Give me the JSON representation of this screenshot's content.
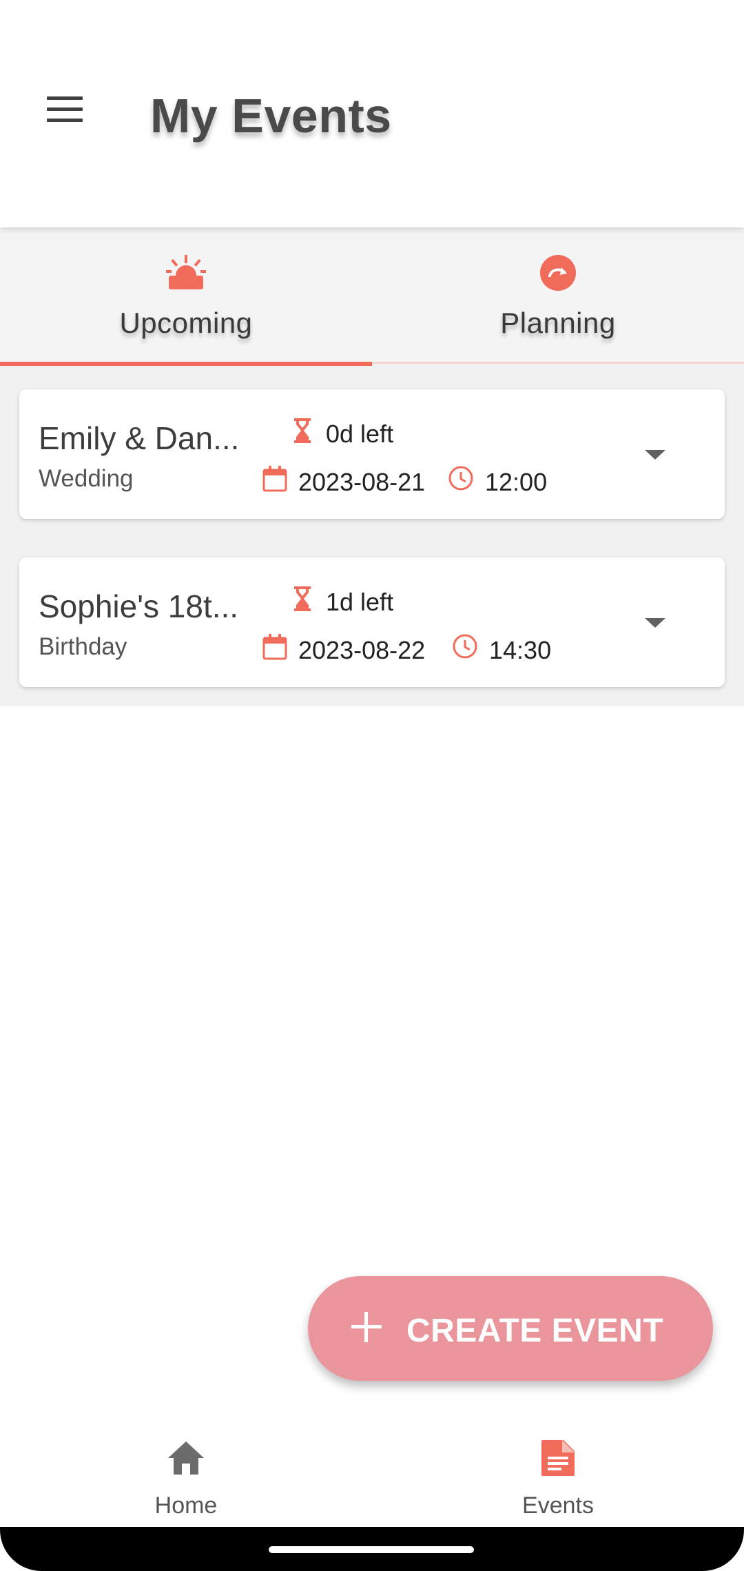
{
  "header": {
    "title": "My Events",
    "menu_icon": "menu-icon"
  },
  "tabs": [
    {
      "label": "Upcoming",
      "icon": "alarm-light-icon",
      "active": true
    },
    {
      "label": "Planning",
      "icon": "redo-circle-icon",
      "active": false
    }
  ],
  "events": [
    {
      "name": "Emily & Dan...",
      "type": "Wedding",
      "time_left": "0d left",
      "date": "2023-08-21",
      "time": "12:00"
    },
    {
      "name": "Sophie's 18t...",
      "type": "Birthday",
      "time_left": "1d left",
      "date": "2023-08-22",
      "time": "14:30"
    }
  ],
  "fab": {
    "label": "CREATE EVENT",
    "icon": "plus-icon"
  },
  "bottom_nav": [
    {
      "label": "Home",
      "icon": "home-icon",
      "active": false
    },
    {
      "label": "Events",
      "icon": "document-icon",
      "active": true
    }
  ],
  "colors": {
    "accent": "#f06b5a",
    "fab": "#e9959b",
    "inactive_icon": "#6b6b6b"
  }
}
